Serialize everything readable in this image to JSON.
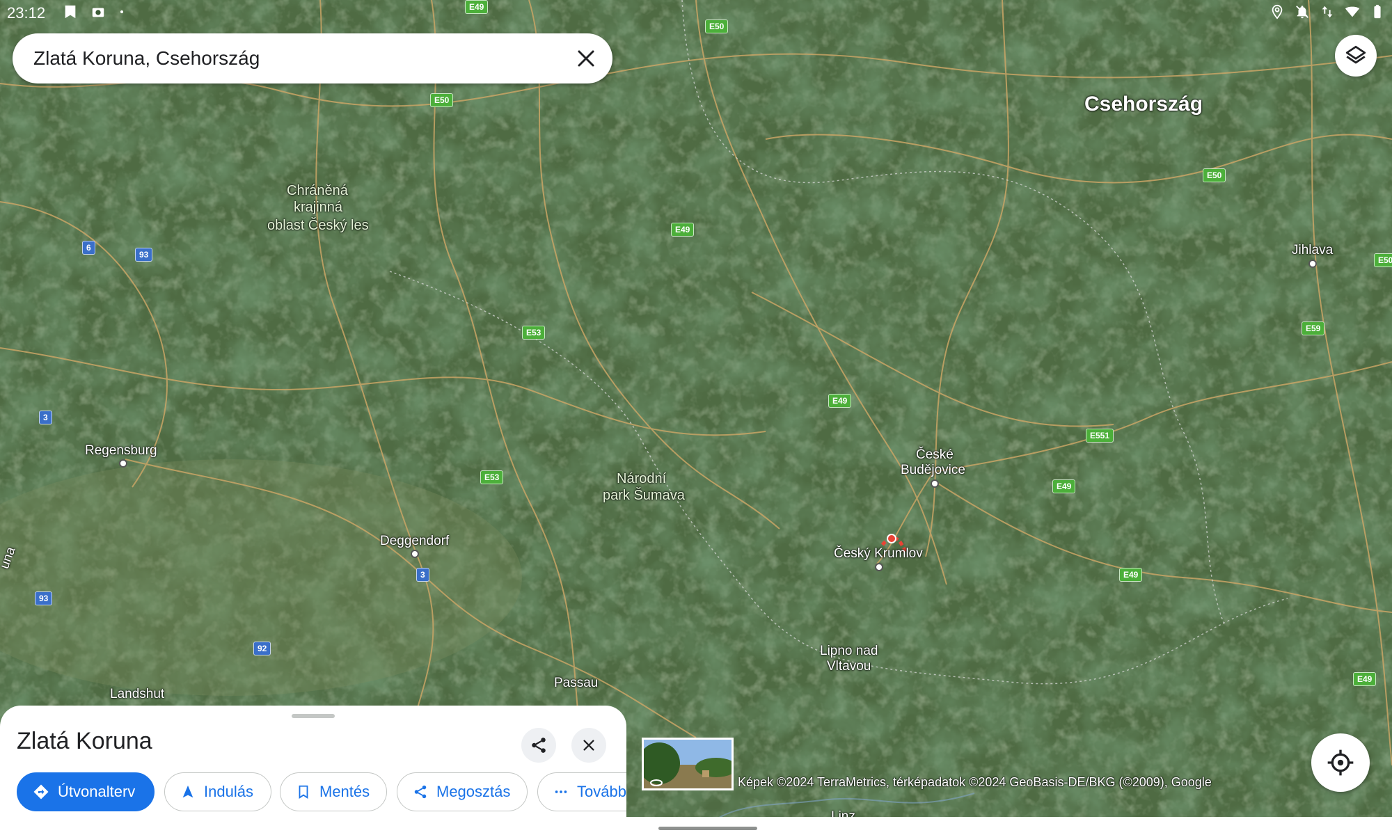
{
  "status_bar": {
    "time": "23:12",
    "left_icons": [
      "bookmark-icon",
      "camera-icon",
      "dot-icon"
    ],
    "right_icons": [
      "location-icon",
      "notifications-off-icon",
      "data-arrows-icon",
      "wifi-icon",
      "battery-icon"
    ]
  },
  "search": {
    "query": "Zlatá Koruna, Csehország"
  },
  "map": {
    "type": "satellite",
    "country_label": "Csehország",
    "places": {
      "regensburg": "Regensburg",
      "deggendorf": "Deggendorf",
      "passau": "Passau",
      "landshut": "Landshut",
      "cb1": "České",
      "cb2": "Budějovice",
      "krumlov": "Český Krumlov",
      "lipno1": "Lipno nad",
      "lipno2": "Vltavou",
      "jihlava": "Jihlava",
      "linz": "Linz",
      "una": "una"
    },
    "parks": {
      "cesky_les_1": "Chráněná",
      "cesky_les_2": "krajinná",
      "cesky_les_3": "oblast Český les",
      "sumava_1": "Národní",
      "sumava_2": "park Šumava"
    },
    "road_shields": {
      "e50_a": "E50",
      "e50_b": "E50",
      "e50_c": "E50",
      "e50_d": "E50",
      "e49_a": "E49",
      "e49_b": "E49",
      "e49_c": "E49",
      "e49_d": "E49",
      "e49_e": "E49",
      "e49_f": "E49",
      "e53_a": "E53",
      "e53_b": "E53",
      "e551": "E551",
      "e59": "E59",
      "r6": "6",
      "r93_a": "93",
      "r93_b": "93",
      "r3_a": "3",
      "r3_b": "3",
      "r92": "92"
    }
  },
  "place_sheet": {
    "title": "Zlatá Koruna",
    "actions": {
      "directions": "Útvonalterv",
      "start": "Indulás",
      "save": "Mentés",
      "share": "Megosztás",
      "more": "További"
    }
  },
  "attribution": "Képek ©2024 TerraMetrics, térképadatok ©2024 GeoBasis-DE/BKG (©2009), Google",
  "colors": {
    "accent": "#1a73e8",
    "route_shield": "#4caf3a",
    "german_shield": "#3a6fc9",
    "pin": "#ea4335"
  }
}
